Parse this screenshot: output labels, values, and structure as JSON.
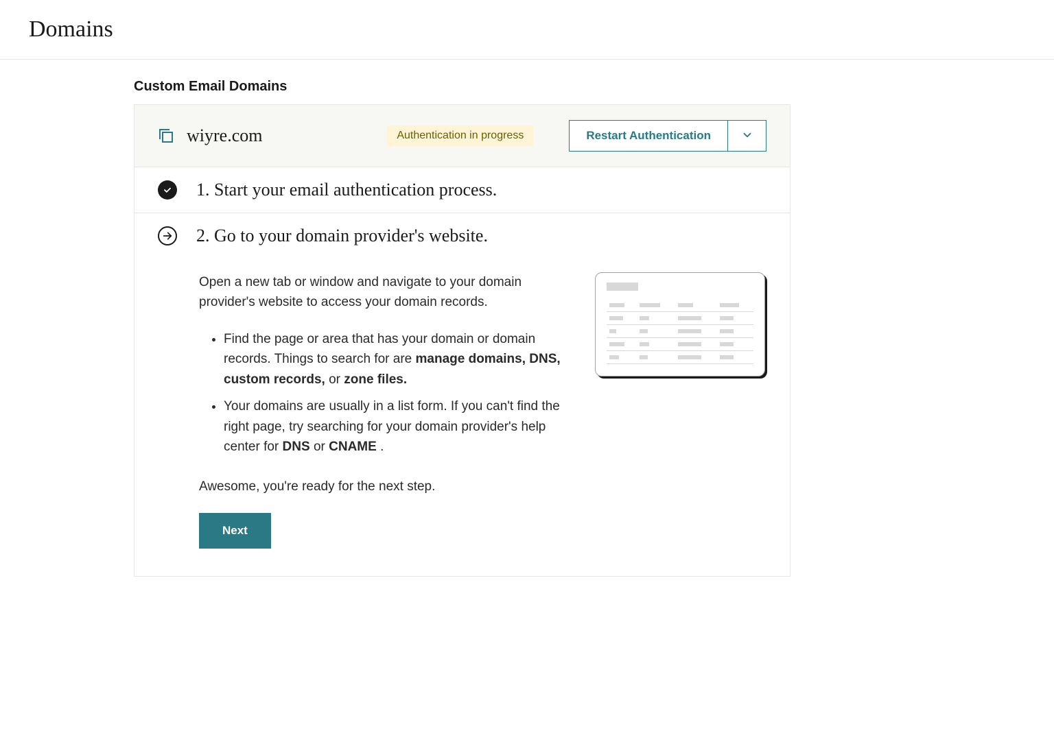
{
  "page": {
    "title": "Domains",
    "sectionHeading": "Custom Email Domains"
  },
  "domain": {
    "name": "wiyre.com",
    "status": "Authentication in progress",
    "restartLabel": "Restart Authentication"
  },
  "steps": {
    "step1": {
      "title": "1. Start your email authentication process."
    },
    "step2": {
      "title": "2. Go to your domain provider's website.",
      "intro": "Open a new tab or window and navigate to your domain provider's website to access your domain records.",
      "bullet1_a": "Find the page or area that has your domain or domain records. Things to search for are ",
      "bullet1_b": "manage domains, DNS, custom records,",
      "bullet1_c": " or ",
      "bullet1_d": "zone files.",
      "bullet2_a": "Your domains are usually in a list form. If you can't find the right page, try searching for your domain provider's help center for ",
      "bullet2_b": "DNS",
      "bullet2_c": " or ",
      "bullet2_d": "CNAME ",
      "bullet2_e": ".",
      "ready": "Awesome, you're ready for the next step.",
      "nextLabel": "Next"
    }
  }
}
